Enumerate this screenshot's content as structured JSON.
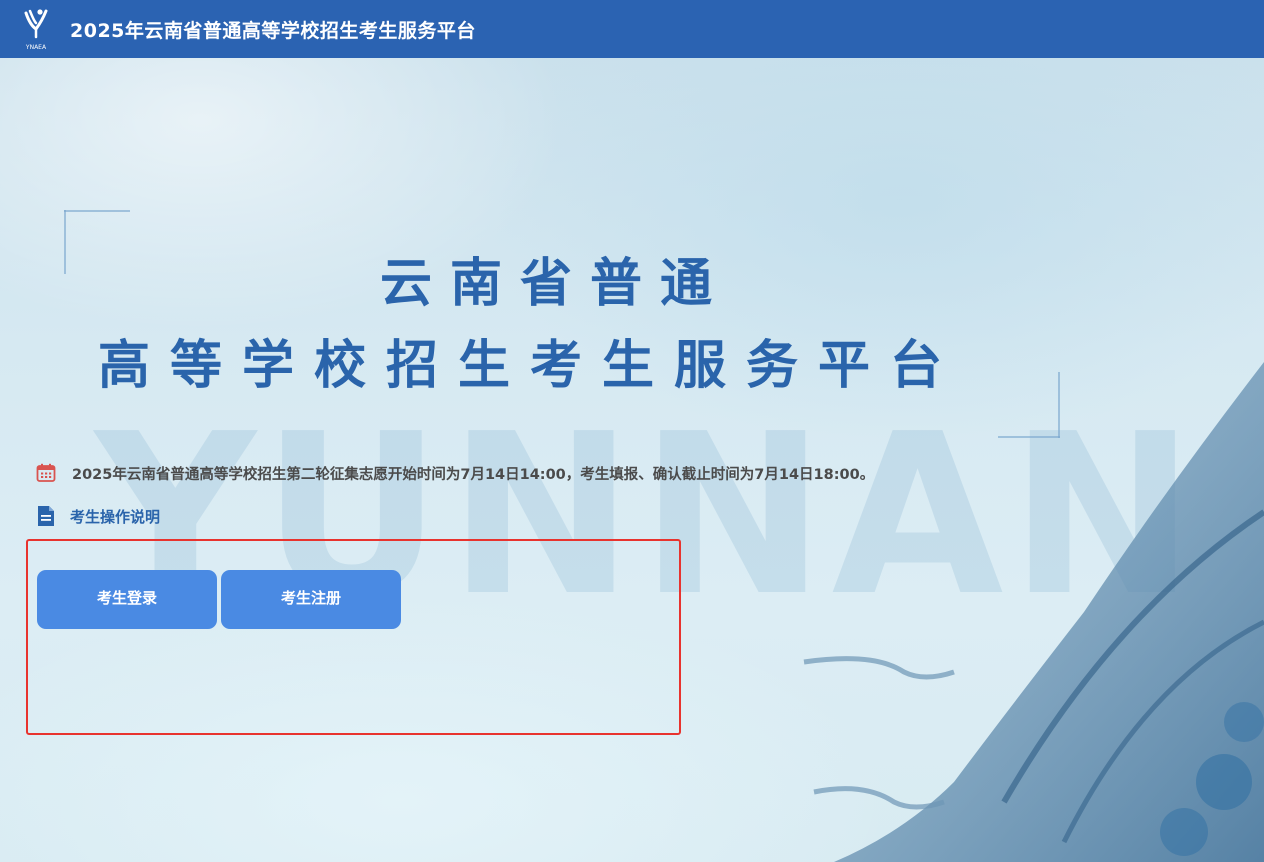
{
  "header": {
    "logo_text": "YNAEA",
    "title": "2025年云南省普通高等学校招生考生服务平台"
  },
  "hero": {
    "line1": "云南省普通",
    "line2": "高等学校招生考生服务平台",
    "watermark": "YUNNAN"
  },
  "notice": {
    "icon": "calendar-icon",
    "text": "2025年云南省普通高等学校招生第二轮征集志愿开始时间为7月14日14:00，考生填报、确认截止时间为7月14日18:00。"
  },
  "guide": {
    "icon": "document-icon",
    "label": "考生操作说明"
  },
  "actions": {
    "login_label": "考生登录",
    "register_label": "考生注册"
  },
  "colors": {
    "header_bg": "#2b63b2",
    "button_bg": "#4a8ae3",
    "hero_text": "#2a64ab",
    "highlight_border": "#e8332e",
    "notice_icon": "#d9534f"
  }
}
